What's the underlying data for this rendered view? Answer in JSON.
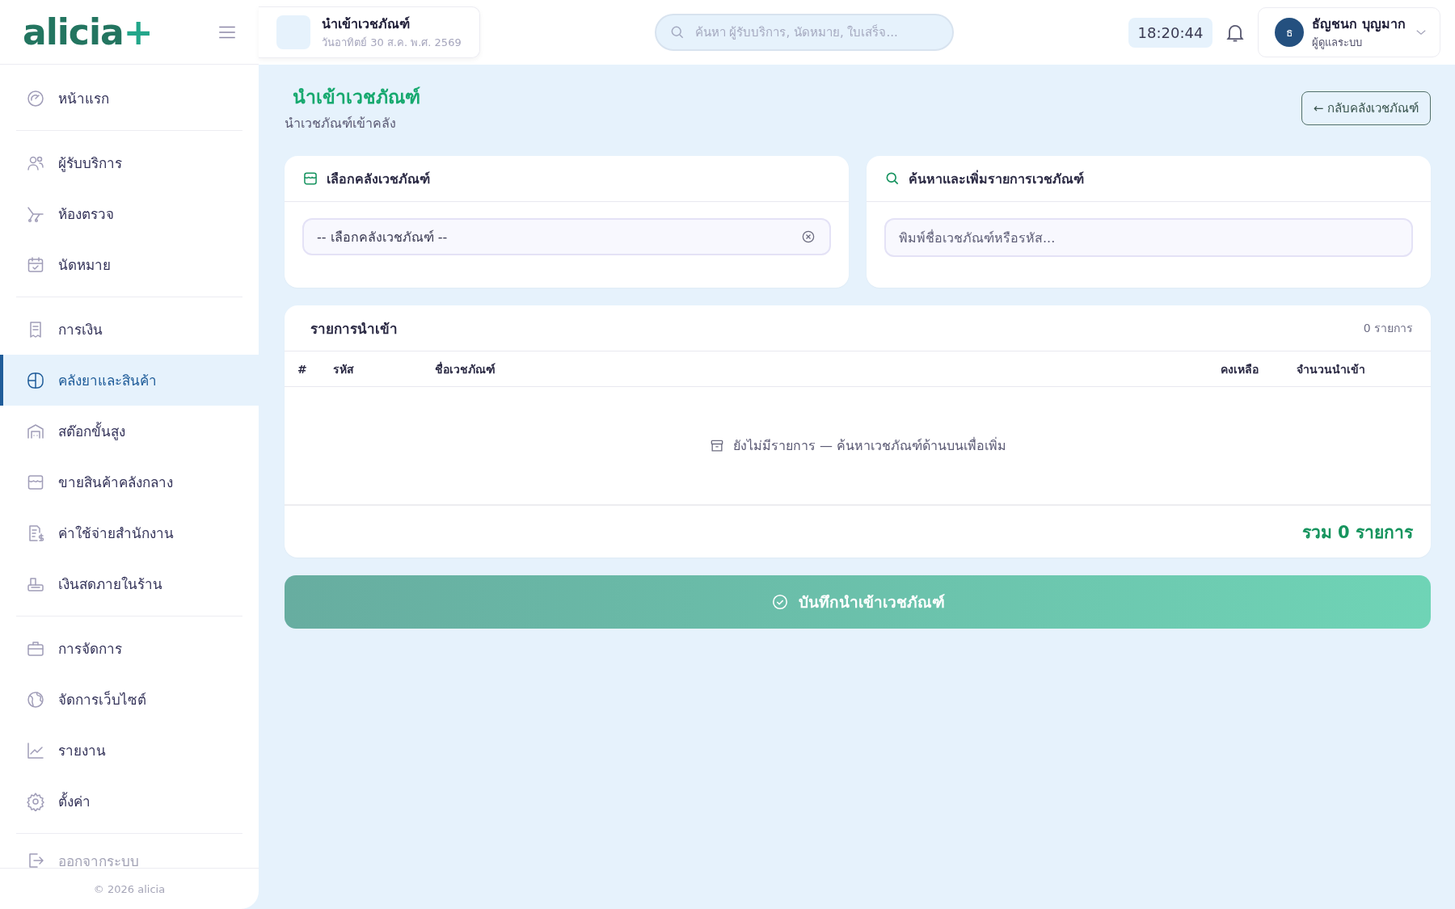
{
  "logo": {
    "text": "alicia",
    "mark": "+"
  },
  "header": {
    "page_title": "นำเข้าเวชภัณฑ์",
    "page_date": "วันอาทิตย์ 30 ส.ค. พ.ศ. 2569",
    "search": {
      "placeholder": "ค้นหา ผู้รับบริการ, นัดหมาย, ใบเสร็จ..."
    },
    "clock": "18:20:44",
    "user": {
      "initial": "ธ",
      "name": "ธัญชนก บุญมาก",
      "role": "ผู้ดูแลระบบ"
    }
  },
  "sidebar": {
    "groups": [
      [
        {
          "label": "หน้าแรก",
          "selected": false
        }
      ],
      [
        {
          "label": "ผู้รับบริการ",
          "selected": false
        },
        {
          "label": "ห้องตรวจ",
          "selected": false
        },
        {
          "label": "นัดหมาย",
          "selected": false
        }
      ],
      [
        {
          "label": "การเงิน",
          "selected": false
        },
        {
          "label": "คลังยาและสินค้า",
          "selected": true
        },
        {
          "label": "สต๊อกขั้นสูง",
          "selected": false
        },
        {
          "label": "ขายสินค้าคลังกลาง",
          "selected": false
        },
        {
          "label": "ค่าใช้จ่ายสำนักงาน",
          "selected": false
        },
        {
          "label": "เงินสดภายในร้าน",
          "selected": false
        }
      ],
      [
        {
          "label": "การจัดการ",
          "selected": false
        },
        {
          "label": "จัดการเว็บไซต์",
          "selected": false
        },
        {
          "label": "รายงาน",
          "selected": false
        },
        {
          "label": "ตั้งค่า",
          "selected": false
        }
      ],
      [
        {
          "label": "ออกจากระบบ",
          "selected": false
        }
      ]
    ],
    "footer": "© 2026 alicia"
  },
  "page": {
    "title": "นำเข้าเวชภัณฑ์",
    "subtitle": "นำเวชภัณฑ์เข้าคลัง",
    "back_button": "← กลับคลังเวชภัณฑ์"
  },
  "warehouse_card": {
    "title": "เลือกคลังเวชภัณฑ์",
    "select_value": "-- เลือกคลังเวชภัณฑ์ --"
  },
  "search_card": {
    "title": "ค้นหาและเพิ่มรายการเวชภัณฑ์",
    "placeholder": "พิมพ์ชื่อเวชภัณฑ์หรือรหัส..."
  },
  "items_table": {
    "title": "รายการนำเข้า",
    "count": "0 รายการ",
    "columns": [
      "#",
      "รหัส",
      "ชื่อเวชภัณฑ์",
      "คงเหลือ",
      "จำนวนนำเข้า"
    ],
    "empty_text": "ยังไม่มีรายการ — ค้นหาเวชภัณฑ์ด้านบนเพื่อเพิ่ม",
    "total": "รวม 0 รายการ"
  },
  "save_button": "บันทึกนำเข้าเวชภัณฑ์"
}
